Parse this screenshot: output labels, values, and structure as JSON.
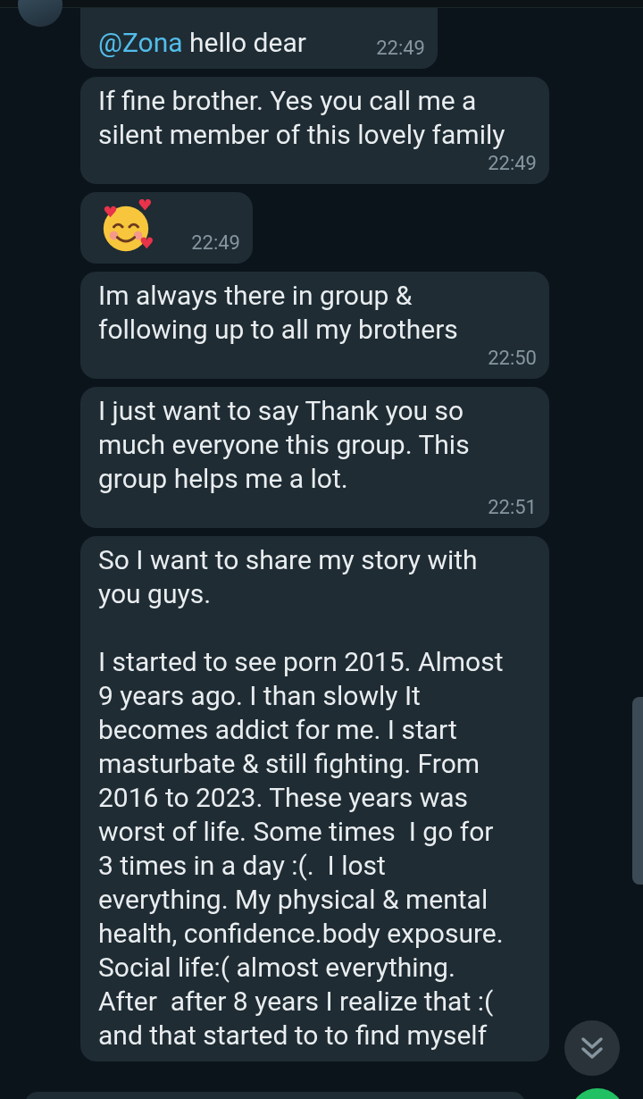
{
  "messages": [
    {
      "kind": "text",
      "mention": "@Zona",
      "text": " hello dear",
      "time": "22:49"
    },
    {
      "kind": "text",
      "text": "If fine brother. Yes you call me a silent member of this lovely family",
      "time": "22:49"
    },
    {
      "kind": "emoji",
      "time": "22:49"
    },
    {
      "kind": "text",
      "text": "Im always there in group & following up to all my brothers",
      "time": "22:50"
    },
    {
      "kind": "text",
      "text": "I just want to say Thank you so much everyone this group. This group helps me a lot.",
      "time": "22:51"
    },
    {
      "kind": "text",
      "text": "So I want to share my story with you guys.\n\nI started to see porn 2015. Almost 9 years ago. I than slowly It becomes addict for me. I start masturbate & still fighting. From 2016 to 2023. These years was worst of life. Some times  I go for 3 times in a day :(.  I lost everything. My physical & mental health, confidence.body exposure. Social life:( almost everything. After  after 8 years I realize that :( and that started to to find myself"
    }
  ]
}
